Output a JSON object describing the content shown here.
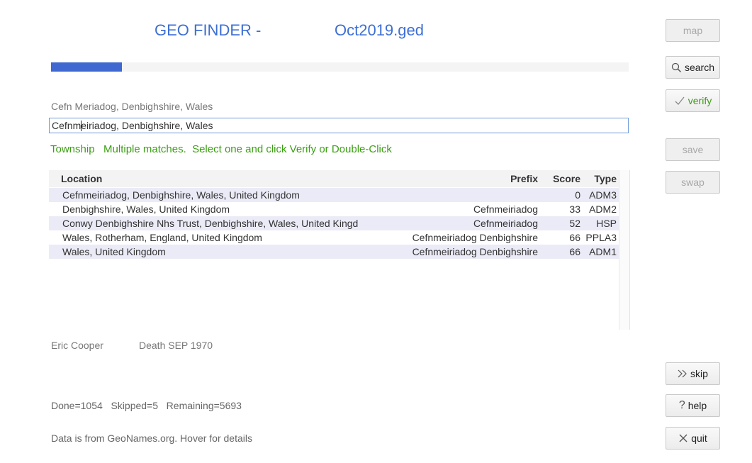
{
  "header": {
    "title_prefix": "GEO FINDER -",
    "title_file": "Oct2019.ged"
  },
  "progress": {
    "fraction": 0.123
  },
  "place": {
    "prior_text": "Cefn Meriadog, Denbighshire, Wales",
    "edit_value": "Cefnmeiriadog, Denbighshire, Wales"
  },
  "status_text": "Township   Multiple matches.  Select one and click Verify or Double-Click",
  "results": {
    "columns": {
      "location": "Location",
      "prefix": "Prefix",
      "score": "Score",
      "type": "Type"
    },
    "rows": [
      {
        "location": "Cefnmeiriadog, Denbighshire, Wales, United Kingdom",
        "prefix": "",
        "score": "0",
        "type": "ADM3"
      },
      {
        "location": "Denbighshire, Wales, United Kingdom",
        "prefix": "Cefnmeiriadog",
        "score": "33",
        "type": "ADM2"
      },
      {
        "location": "Conwy Denbighshire Nhs Trust, Denbighshire, Wales, United Kingd",
        "prefix": "Cefnmeiriadog",
        "score": "52",
        "type": "HSP"
      },
      {
        "location": "Wales, Rotherham, England, United Kingdom",
        "prefix": "Cefnmeiriadog Denbighshire",
        "score": "66",
        "type": "PPLA3"
      },
      {
        "location": "Wales, United Kingdom",
        "prefix": "Cefnmeiriadog Denbighshire",
        "score": "66",
        "type": "ADM1"
      }
    ]
  },
  "person": {
    "name": "Eric Cooper",
    "event": "Death SEP 1970"
  },
  "counts_text": "Done=1054   Skipped=5   Remaining=5693",
  "source_text": "Data is from GeoNames.org.  Hover for details",
  "buttons": {
    "map": "map",
    "search": "search",
    "verify": "verify",
    "save": "save",
    "swap": "swap",
    "skip": "skip",
    "help": "help",
    "quit": "quit"
  },
  "icons": {
    "search": "magnifier-icon",
    "verify": "checkmark-icon",
    "skip": "double-chevron-right-icon",
    "help": "question-mark-icon",
    "quit": "x-icon"
  },
  "colors": {
    "title": "#3d6fd4",
    "progress": "#3f69d0",
    "status": "#3b9e13",
    "row_alt": "#ebebf7"
  }
}
